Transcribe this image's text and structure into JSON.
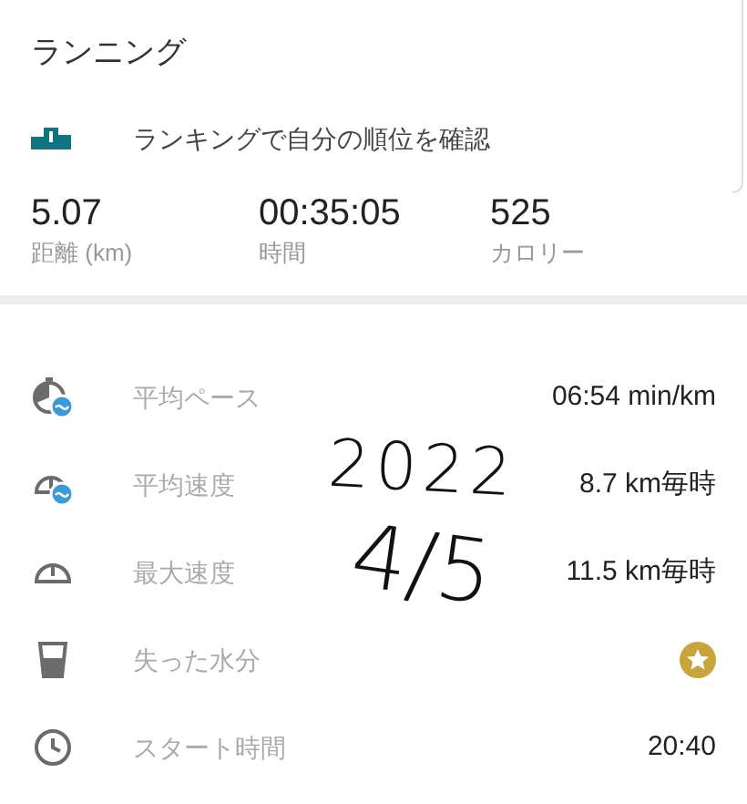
{
  "title": "ランニング",
  "ranking_link": "ランキングで自分の順位を確認",
  "stats": [
    {
      "value": "5.07",
      "label": "距離 (km)"
    },
    {
      "value": "00:35:05",
      "label": "時間"
    },
    {
      "value": "525",
      "label": "カロリー"
    }
  ],
  "metrics": [
    {
      "label": "平均ペース",
      "kind": "text",
      "value": "06:54 min/km"
    },
    {
      "label": "平均速度",
      "kind": "text",
      "value": "8.7 km毎時"
    },
    {
      "label": "最大速度",
      "kind": "text",
      "value": "11.5 km毎時"
    },
    {
      "label": "失った水分",
      "kind": "premium"
    },
    {
      "label": "スタート時間",
      "kind": "text",
      "value": "20:40"
    }
  ],
  "handwriting": [
    "2022",
    "4/5"
  ]
}
